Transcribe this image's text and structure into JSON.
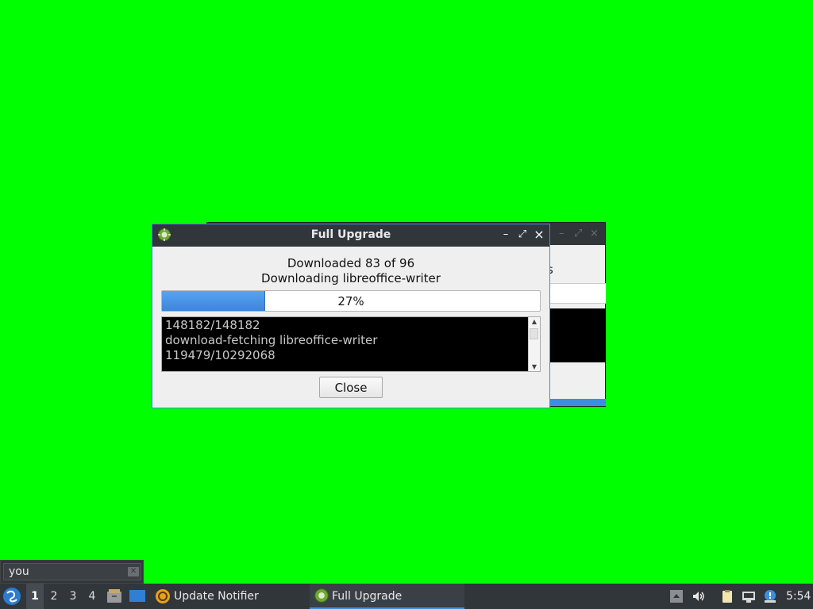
{
  "background_window": {
    "partial_text": "s"
  },
  "dialog": {
    "title": "Full Upgrade",
    "status_line1": "Downloaded 83 of 96",
    "status_line2": "Downloading libreoffice-writer",
    "progress_fraction": 0.27,
    "progress_text": "27%",
    "log_lines": [
      "148182/148182",
      "download-fetching libreoffice-writer",
      "119479/10292068"
    ],
    "close_label": "Close",
    "controls": {
      "minimize": "–",
      "maximize": "⤢",
      "close": "×"
    }
  },
  "search": {
    "value": "you",
    "clear_icon": "✕"
  },
  "taskbar": {
    "workspaces": [
      "1",
      "2",
      "3",
      "4"
    ],
    "active_workspace": "1",
    "tasks": [
      {
        "label": "Update Notifier",
        "icon": "update-notifier-icon"
      },
      {
        "label": "Full Upgrade",
        "icon": "gear-icon"
      }
    ],
    "clock": "5:54"
  },
  "colors": {
    "desktop": "#00ff00",
    "accent": "#3d8ee0",
    "titlebar": "#31363b"
  }
}
